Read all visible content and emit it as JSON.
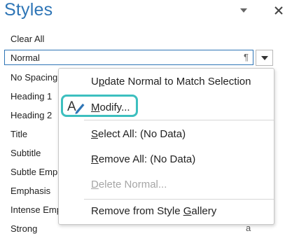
{
  "pane": {
    "title": "Styles",
    "clear_all": "Clear All",
    "current_style": "Normal",
    "current_style_mark": "¶",
    "styles": [
      "No Spacing",
      "Heading 1",
      "Heading 2",
      "Title",
      "Subtitle",
      "Subtle Emph",
      "Emphasis",
      "Intense Emp",
      "Strong"
    ],
    "strong_mark": "a"
  },
  "menu": {
    "update": {
      "pre": "U",
      "u": "p",
      "post": "date Normal to Match Selection"
    },
    "modify": {
      "pre": "",
      "u": "M",
      "post": "odify..."
    },
    "select_all": {
      "pre": "",
      "u": "S",
      "post": "elect All: (No Data)"
    },
    "remove_all": {
      "pre": "",
      "u": "R",
      "post": "emove All: (No Data)"
    },
    "delete": {
      "pre": "",
      "u": "D",
      "post": "elete Normal..."
    },
    "remove_gallery": {
      "pre": "Remove from Style ",
      "u": "G",
      "post": "allery"
    }
  },
  "colors": {
    "accent": "#2e75b6",
    "highlight": "#3dbfbf"
  },
  "icons": [
    "chevron-down-icon",
    "close-icon",
    "modify-style-icon"
  ]
}
